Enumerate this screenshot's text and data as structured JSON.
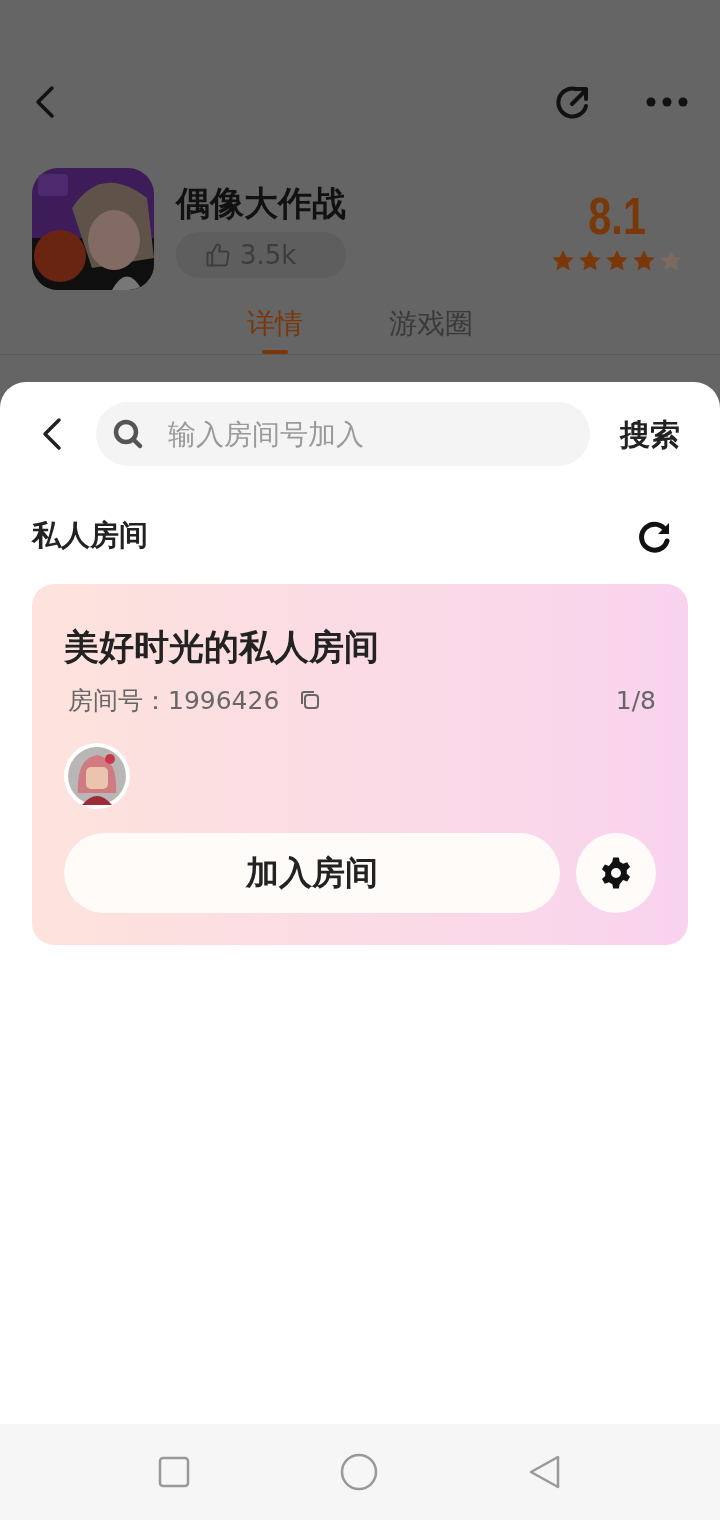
{
  "app": {
    "name": "偶像大作战",
    "likes": "3.5k",
    "rating": "8.1",
    "stars": 4
  },
  "tabs": [
    {
      "label": "详情",
      "selected": true
    },
    {
      "label": "游戏圈",
      "selected": false
    }
  ],
  "search": {
    "placeholder": "输入房间号加入",
    "button": "搜索"
  },
  "section": {
    "title": "私人房间"
  },
  "rooms": [
    {
      "name": "美好时光的私人房间",
      "id_label": "房间号：",
      "id": "1996426",
      "count": "1/8",
      "join": "加入房间"
    }
  ]
}
